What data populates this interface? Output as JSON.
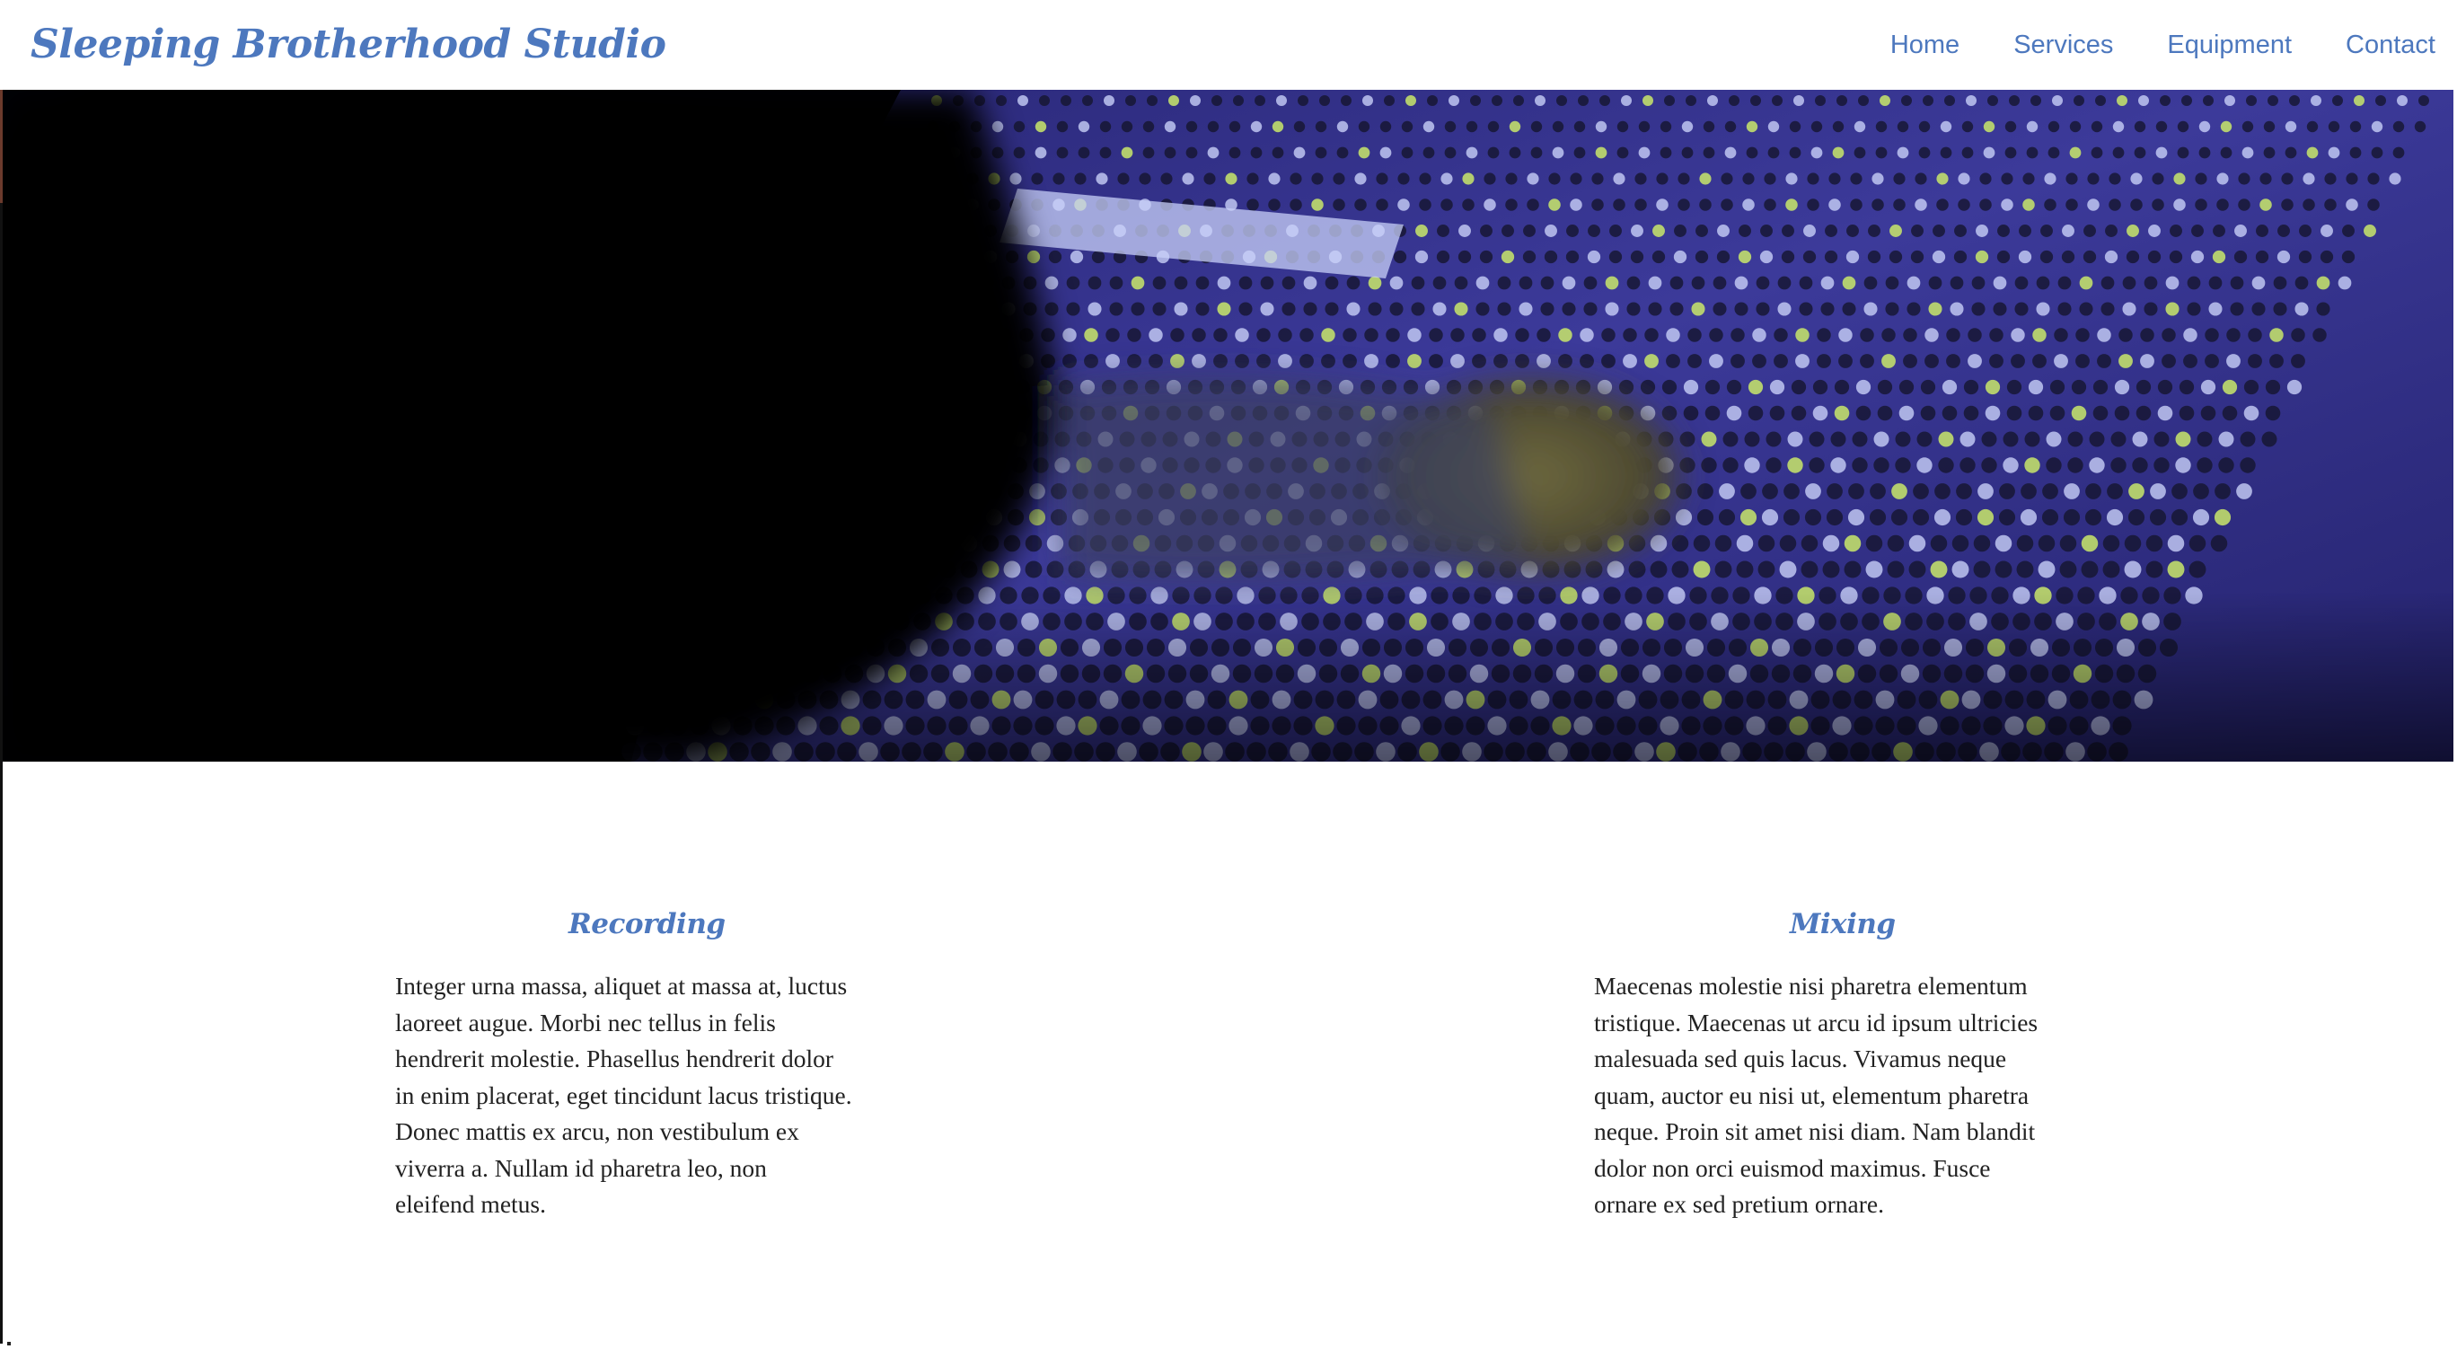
{
  "header": {
    "brand": "Sleeping Brotherhood Studio",
    "nav": [
      "Home",
      "Services",
      "Equipment",
      "Contact"
    ]
  },
  "hero": {
    "image": "mixing console close-up with engineer's hand",
    "colors": {
      "shadow": "#000208",
      "console": "#3c3a9a",
      "highlight": "#c8d0f8",
      "led": "#c9e86a"
    }
  },
  "services": [
    {
      "title": "Recording",
      "lines": [
        "Integer urna massa, aliquet at massa at, luctus",
        "laoreet augue. Morbi nec tellus in felis",
        "hendrerit molestie. Phasellus hendrerit dolor",
        "in enim placerat, eget tincidunt lacus tristique.",
        "Donec mattis ex arcu, non vestibulum ex",
        "viverra a. Nullam id pharetra leo, non",
        "eleifend metus."
      ]
    },
    {
      "title": "Mixing",
      "lines": [
        "Maecenas molestie nisi pharetra elementum",
        "tristique. Maecenas ut arcu id ipsum ultricies",
        "malesuada sed quis lacus. Vivamus neque",
        "quam, auctor eu nisi ut, elementum pharetra",
        "neque. Proin sit amet nisi diam. Nam blandit",
        "dolor non orci euismod maximus. Fusce",
        "ornare ex sed pretium ornare."
      ]
    }
  ],
  "theme": {
    "accent": "#4d78be",
    "text": "#222222",
    "background": "#ffffff"
  }
}
